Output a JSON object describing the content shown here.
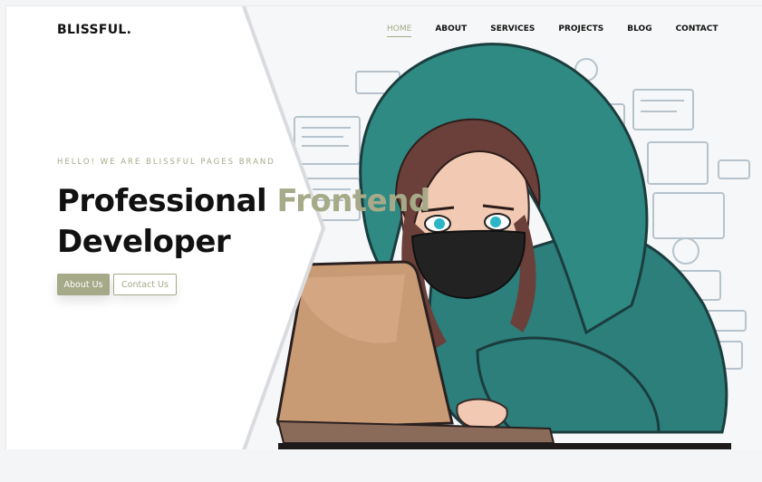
{
  "brand": {
    "name": "BLISSFUL."
  },
  "nav": {
    "items": [
      {
        "label": "HOME",
        "active": true
      },
      {
        "label": "ABOUT",
        "active": false
      },
      {
        "label": "SERVICES",
        "active": false
      },
      {
        "label": "PROJECTS",
        "active": false
      },
      {
        "label": "BLOG",
        "active": false
      },
      {
        "label": "CONTACT",
        "active": false
      }
    ]
  },
  "hero": {
    "eyebrow": "HELLO! WE ARE BLISSFUL PAGES BRAND",
    "headline_part1": "Professional",
    "headline_accent": "Frontend",
    "headline_line2": "Developer",
    "primary_button": "About Us",
    "secondary_button": "Contact Us",
    "illustration": "hooded-developer-with-laptop-illustration"
  },
  "colors": {
    "accent": "#a6aa88",
    "text": "#111111",
    "background": "#ffffff",
    "hoodie": "#2a7d78",
    "laptop": "#c99b75"
  }
}
